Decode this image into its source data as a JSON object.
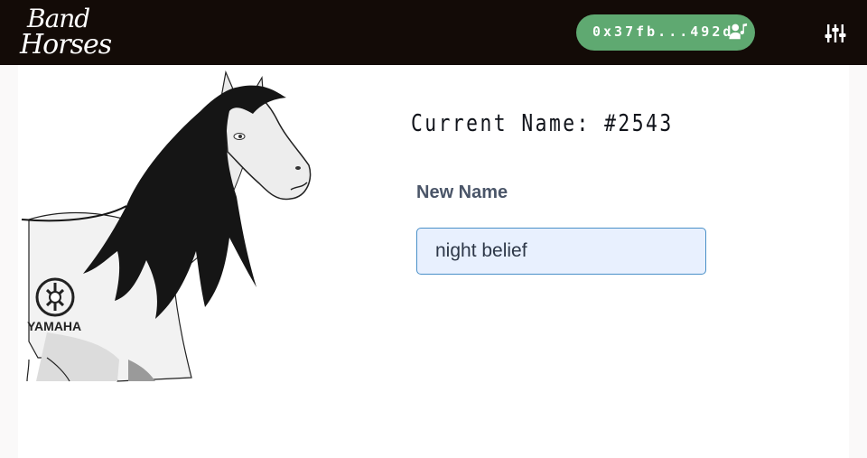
{
  "brand": {
    "logo_line1": "Band",
    "logo_line2": "Horses"
  },
  "wallet": {
    "address": "0x37fb...492d",
    "icon": "account-music-icon",
    "color": "#5fa971"
  },
  "header": {
    "settings_icon": "sliders-icon",
    "background": "#130b07"
  },
  "nft": {
    "image_icon": "horse-illustration",
    "sponsor": "YAMAHA",
    "sponsor_icon": "yamaha-tuning-fork-logo"
  },
  "form": {
    "current_name": "Current Name: #2543",
    "new_name_label": "New Name",
    "new_name_value": "night belief"
  }
}
